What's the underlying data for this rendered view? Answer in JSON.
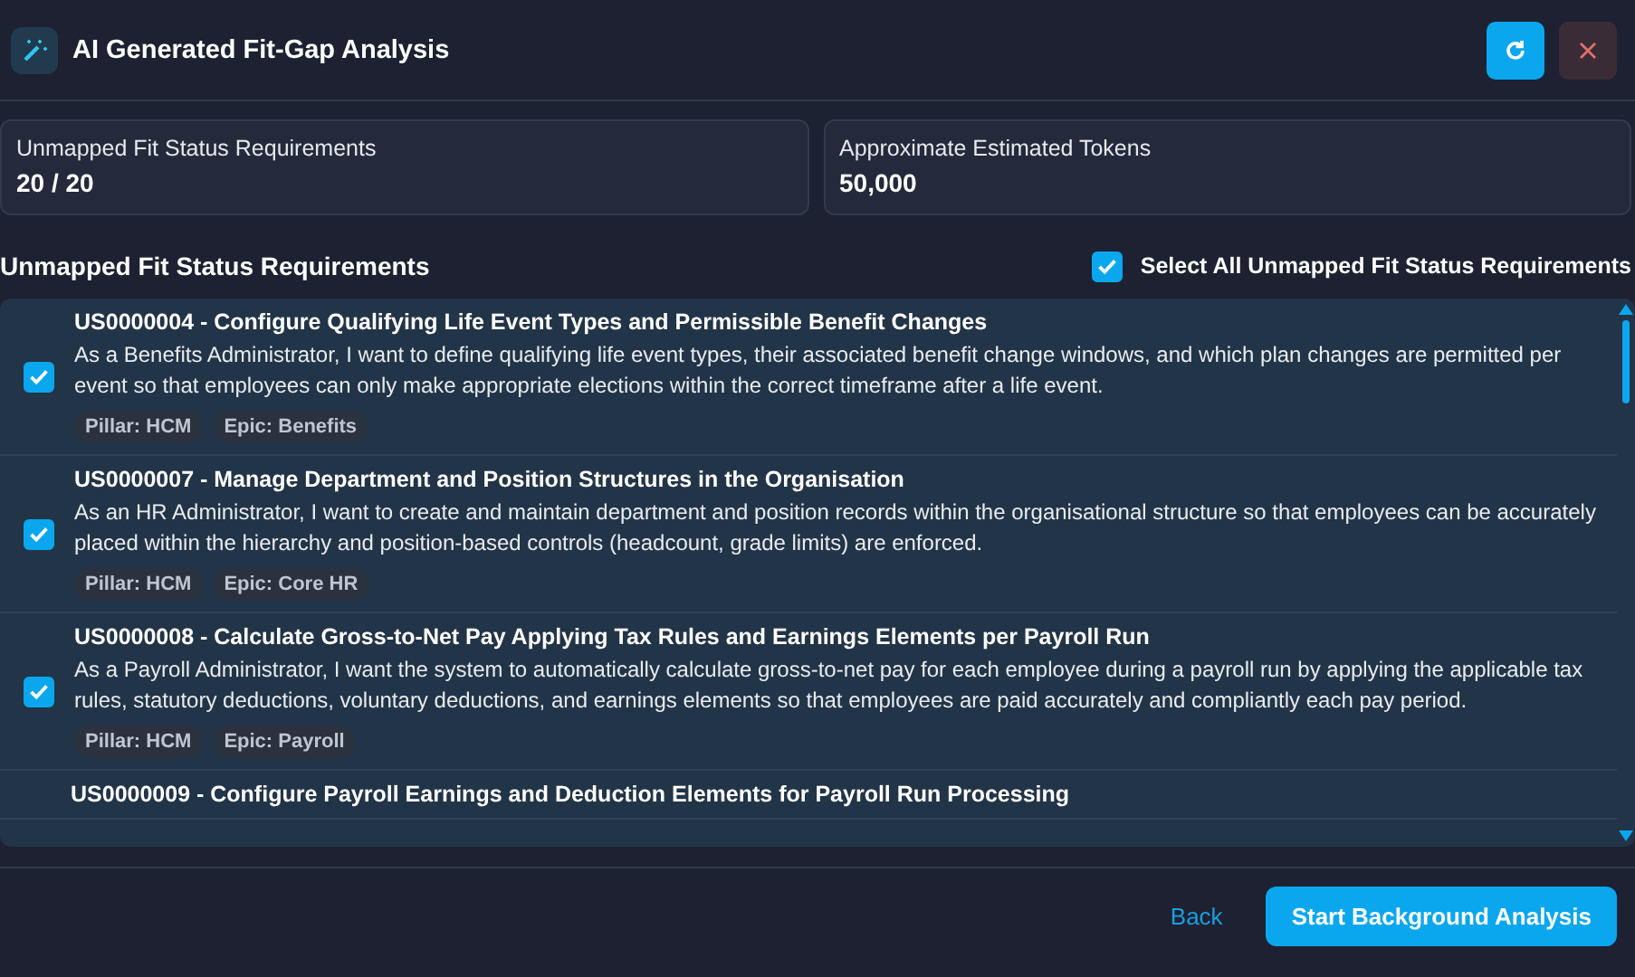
{
  "window": {
    "title": "AI Generated Fit-Gap Analysis"
  },
  "stats": [
    {
      "label": "Unmapped Fit Status Requirements",
      "value": "20 / 20"
    },
    {
      "label": "Approximate Estimated Tokens",
      "value": "50,000"
    }
  ],
  "section": {
    "title": "Unmapped Fit Status Requirements",
    "select_all": {
      "label": "Select All Unmapped Fit Status Requirements",
      "checked": true
    }
  },
  "requirements": [
    {
      "title": "US0000004 - Configure Qualifying Life Event Types and Permissible Benefit Changes",
      "description": "As a Benefits Administrator, I want to define qualifying life event types, their associated benefit change windows, and which plan changes are permitted per event so that employees can only make appropriate elections within the correct timeframe after a life event.",
      "tags": [
        "Pillar: HCM",
        "Epic: Benefits"
      ],
      "checked": true
    },
    {
      "title": "US0000007 - Manage Department and Position Structures in the Organisation",
      "description": "As an HR Administrator, I want to create and maintain department and position records within the organisational structure so that employees can be accurately placed within the hierarchy and position-based controls (headcount, grade limits) are enforced.",
      "tags": [
        "Pillar: HCM",
        "Epic: Core HR"
      ],
      "checked": true
    },
    {
      "title": "US0000008 - Calculate Gross-to-Net Pay Applying Tax Rules and Earnings Elements per Payroll Run",
      "description": "As a Payroll Administrator, I want the system to automatically calculate gross-to-net pay for each employee during a payroll run by applying the applicable tax rules, statutory deductions, voluntary deductions, and earnings elements so that employees are paid accurately and compliantly each pay period.",
      "tags": [
        "Pillar: HCM",
        "Epic: Payroll"
      ],
      "checked": true
    },
    {
      "title": "US0000009 - Configure Payroll Earnings and Deduction Elements for Payroll Run Processing"
    }
  ],
  "footer": {
    "back": "Back",
    "start": "Start Background Analysis"
  }
}
